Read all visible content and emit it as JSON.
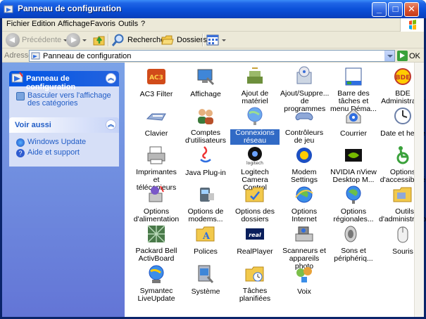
{
  "window": {
    "title": "Panneau de configuration"
  },
  "menu": [
    "Fichier",
    "Edition",
    "Affichage",
    "Favoris",
    "Outils",
    "?"
  ],
  "toolbar": {
    "back": "Précédente",
    "search": "Rechercher",
    "folders": "Dossiers"
  },
  "address": {
    "label": "Adresse",
    "value": "Panneau de configuration",
    "go": "OK"
  },
  "sidebar": {
    "panel1": {
      "title": "Panneau de configuration",
      "link": "Basculer vers l'affichage des catégories"
    },
    "panel2": {
      "title": "Voir aussi",
      "links": [
        "Windows Update",
        "Aide et support"
      ]
    }
  },
  "items": [
    {
      "label": "AC3 Filter",
      "icon": "ac3-filter-icon"
    },
    {
      "label": "Affichage",
      "icon": "display-icon"
    },
    {
      "label": "Ajout de matériel",
      "icon": "add-hardware-icon"
    },
    {
      "label": "Ajout/Suppre... de programmes",
      "icon": "add-remove-programs-icon"
    },
    {
      "label": "Barre des tâches et menu Déma...",
      "icon": "taskbar-icon"
    },
    {
      "label": "BDE Administrator",
      "icon": "bde-icon"
    },
    {
      "label": "Clavier",
      "icon": "keyboard-icon"
    },
    {
      "label": "Comptes d'utilisateurs",
      "icon": "user-accounts-icon"
    },
    {
      "label": "Connexions réseau",
      "icon": "network-icon",
      "selected": true
    },
    {
      "label": "Contrôleurs de jeu",
      "icon": "game-controller-icon"
    },
    {
      "label": "Courrier",
      "icon": "mail-icon"
    },
    {
      "label": "Date et heure",
      "icon": "date-time-icon"
    },
    {
      "label": "Imprimantes et télécopieurs",
      "icon": "printer-icon"
    },
    {
      "label": "Java Plug-in",
      "icon": "java-icon"
    },
    {
      "label": "Logitech Camera Control",
      "icon": "logitech-icon"
    },
    {
      "label": "Modem Settings",
      "icon": "modem-icon"
    },
    {
      "label": "NVIDIA nView Desktop M...",
      "icon": "nvidia-icon"
    },
    {
      "label": "Options d'accessibilité",
      "icon": "accessibility-icon"
    },
    {
      "label": "Options d'alimentation",
      "icon": "power-icon"
    },
    {
      "label": "Options de modems...",
      "icon": "phone-modem-icon"
    },
    {
      "label": "Options des dossiers",
      "icon": "folder-options-icon"
    },
    {
      "label": "Options Internet",
      "icon": "internet-options-icon"
    },
    {
      "label": "Options régionales...",
      "icon": "regional-icon"
    },
    {
      "label": "Outils d'administration",
      "icon": "admin-tools-icon"
    },
    {
      "label": "Packard Bell ActivBoard",
      "icon": "activboard-icon"
    },
    {
      "label": "Polices",
      "icon": "fonts-icon"
    },
    {
      "label": "RealPlayer",
      "icon": "realplayer-icon"
    },
    {
      "label": "Scanneurs et appareils photo",
      "icon": "scanner-icon"
    },
    {
      "label": "Sons et périphériq...",
      "icon": "sounds-icon"
    },
    {
      "label": "Souris",
      "icon": "mouse-icon"
    },
    {
      "label": "Symantec LiveUpdate",
      "icon": "liveupdate-icon"
    },
    {
      "label": "Système",
      "icon": "system-icon"
    },
    {
      "label": "Tâches planifiées",
      "icon": "scheduled-tasks-icon"
    },
    {
      "label": "Voix",
      "icon": "speech-icon"
    }
  ]
}
